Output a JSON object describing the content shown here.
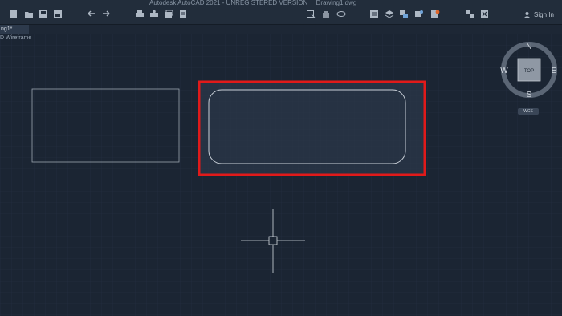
{
  "window": {
    "app_title": "Autodesk AutoCAD 2021 - UNREGISTERED VERSION",
    "file_name": "Drawing1.dwg"
  },
  "user": {
    "sign_in_label": "Sign In"
  },
  "toolbar": {
    "icons": [
      "new-icon",
      "open-icon",
      "save-icon",
      "save-as-icon",
      "undo-icon",
      "redo-icon",
      "plot-icon",
      "plot-preview-icon",
      "batch-plot-icon",
      "publish-icon",
      "select-icon",
      "layer-icon",
      "pan-icon",
      "orbit-icon",
      "properties-icon",
      "layer-properties-icon",
      "match-properties-icon",
      "block-icon",
      "quick-properties-icon",
      "tools-icon",
      "close-panel-icon"
    ]
  },
  "document": {
    "tab_label": "ng1*"
  },
  "viewport": {
    "label": "D Wireframe"
  },
  "viewcube": {
    "top_label": "TOP",
    "north": "N",
    "south": "S",
    "east": "E",
    "west": "W",
    "wcs_label": "WCS"
  },
  "colors": {
    "background": "#1b2533",
    "highlight": "#e11a1a",
    "grid": "#263245",
    "geometry": "#c9d0d8"
  }
}
